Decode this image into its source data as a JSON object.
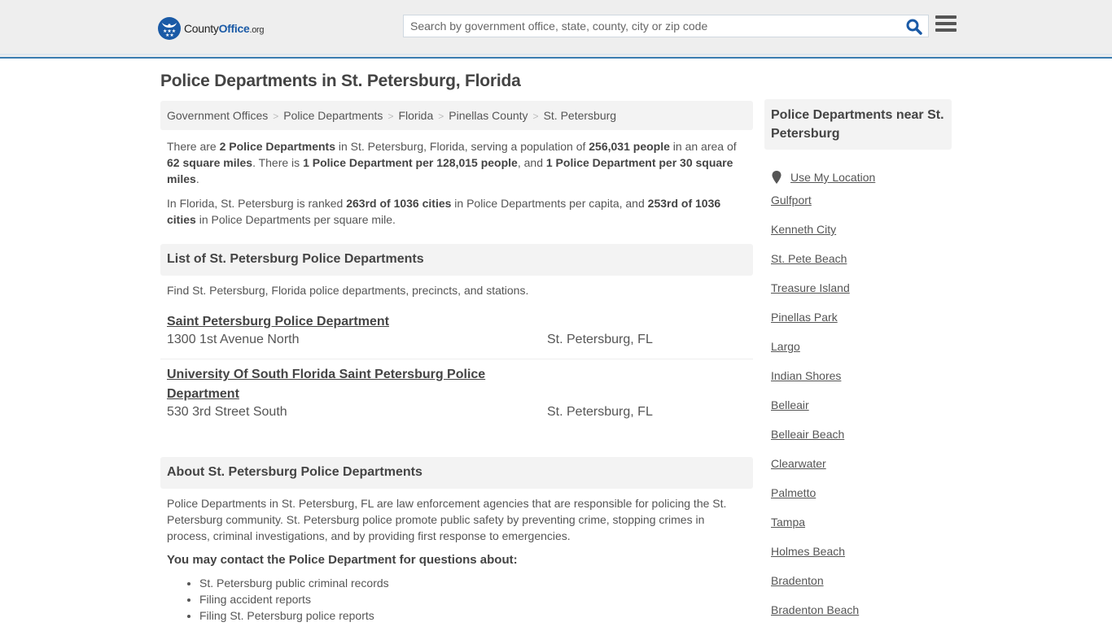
{
  "header": {
    "logo_text_main": "County",
    "logo_text_accent": "Office",
    "logo_text_suffix": ".org",
    "search_placeholder": "Search by government office, state, county, city or zip code",
    "brand_color": "#1a5aa6"
  },
  "page_title": "Police Departments in St. Petersburg, Florida",
  "breadcrumb": [
    "Government Offices",
    "Police Departments",
    "Florida",
    "Pinellas County",
    "St. Petersburg"
  ],
  "intro": {
    "p1": {
      "t1": "There are ",
      "b1": "2 Police Departments",
      "t2": " in St. Petersburg, Florida, serving a population of ",
      "b2": "256,031 people",
      "t3": " in an area of ",
      "b3": "62 square miles",
      "t4": ". There is ",
      "b4": "1 Police Department per 128,015 people",
      "t5": ", and ",
      "b5": "1 Police Department per 30 square miles",
      "t6": "."
    },
    "p2": {
      "t1": "In Florida, St. Petersburg is ranked ",
      "b1": "263rd of 1036 cities",
      "t2": " in Police Departments per capita, and ",
      "b2": "253rd of 1036 cities",
      "t3": " in Police Departments per square mile."
    }
  },
  "list_section": {
    "heading": "List of St. Petersburg Police Departments",
    "description": "Find St. Petersburg, Florida police departments, precincts, and stations.",
    "departments": [
      {
        "name": "Saint Petersburg Police Department",
        "address": "1300 1st Avenue North",
        "city": "St. Petersburg, FL"
      },
      {
        "name": "University Of South Florida Saint Petersburg Police Department",
        "address": "530 3rd Street South",
        "city": "St. Petersburg, FL"
      }
    ]
  },
  "about_section": {
    "heading": "About St. Petersburg Police Departments",
    "body": "Police Departments in St. Petersburg, FL are law enforcement agencies that are responsible for policing the St. Petersburg community. St. Petersburg police promote public safety by preventing crime, stopping crimes in process, criminal investigations, and by providing first response to emergencies.",
    "contact_heading": "You may contact the Police Department for questions about:",
    "contact_items": [
      "St. Petersburg public criminal records",
      "Filing accident reports",
      "Filing St. Petersburg police reports"
    ]
  },
  "sidebar": {
    "heading": "Police Departments near St. Petersburg",
    "use_location": "Use My Location",
    "nearby": [
      "Gulfport",
      "Kenneth City",
      "St. Pete Beach",
      "Treasure Island",
      "Pinellas Park",
      "Largo",
      "Indian Shores",
      "Belleair",
      "Belleair Beach",
      "Clearwater",
      "Palmetto",
      "Tampa",
      "Holmes Beach",
      "Bradenton",
      "Bradenton Beach"
    ]
  }
}
